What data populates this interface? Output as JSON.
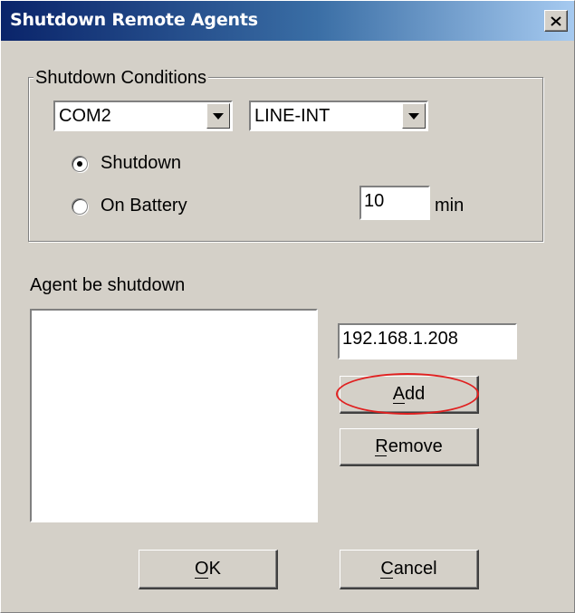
{
  "window": {
    "title": "Shutdown Remote Agents",
    "close_icon": "close-icon"
  },
  "conditions": {
    "group_label": "Shutdown Conditions",
    "port_select": {
      "value": "COM2"
    },
    "model_select": {
      "value": "LINE-INT"
    },
    "radio_shutdown": {
      "label": "Shutdown",
      "checked": true
    },
    "radio_on_battery": {
      "label": "On Battery",
      "checked": false
    },
    "minutes_input": {
      "value": "10"
    },
    "minutes_unit": "min"
  },
  "agents": {
    "label": "Agent be shutdown",
    "list_items": [],
    "ip_input": {
      "value": "192.168.1.208"
    },
    "add_label": "Add",
    "remove_label": "Remove"
  },
  "footer": {
    "ok_label": "OK",
    "cancel_label": "Cancel"
  },
  "annotation": {
    "highlight_color": "#e02020"
  },
  "colors": {
    "dialog_bg": "#d4d0c8",
    "title_start": "#0a246a",
    "title_end": "#a6caf0"
  }
}
